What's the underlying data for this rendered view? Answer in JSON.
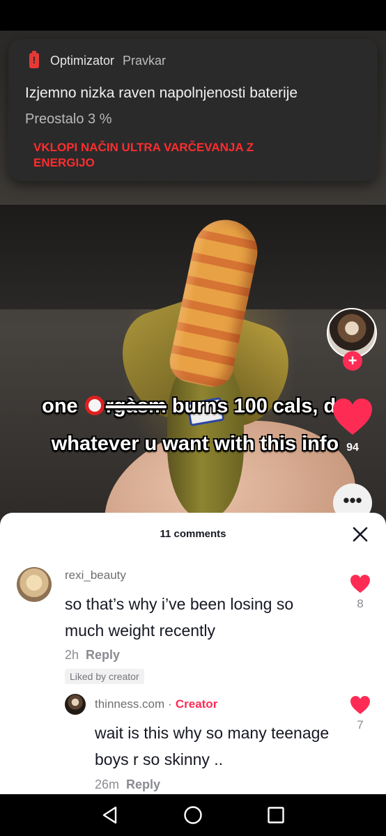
{
  "notification": {
    "app_name": "Optimizator",
    "time": "Pravkar",
    "title": "Izjemno nizka raven napolnjenosti baterije",
    "body": "Preostalo 3 %",
    "action": "VKLOPI NAČIN ULTRA VARČEVANJA Z ENERGIJO",
    "icon": "battery-alert-icon",
    "accent_color": "#e53935"
  },
  "video": {
    "caption_before": "one ",
    "caption_strike": "rgàsm",
    "caption_after": " burns 100 cals, do whatever u want with this info",
    "like_count": "94",
    "follow_icon": "+",
    "more_icon": "•••"
  },
  "comments": {
    "count_label": "11 comments",
    "items": [
      {
        "username": "rexi_beauty",
        "text": "so that’s why i’ve been losing so much weight recently",
        "time": "2h",
        "reply_label": "Reply",
        "liked_by_creator": "Liked by creator",
        "likes": "8"
      },
      {
        "username": "thinness.com",
        "separator": "·",
        "creator_label": "Creator",
        "text": "wait is this why so many teenage boys r so skinny ..",
        "time": "26m",
        "reply_label": "Reply",
        "likes": "7"
      }
    ]
  },
  "colors": {
    "like_red": "#fe2c55",
    "sheet_bg": "#ffffff",
    "notif_bg": "#2a2a2b"
  }
}
